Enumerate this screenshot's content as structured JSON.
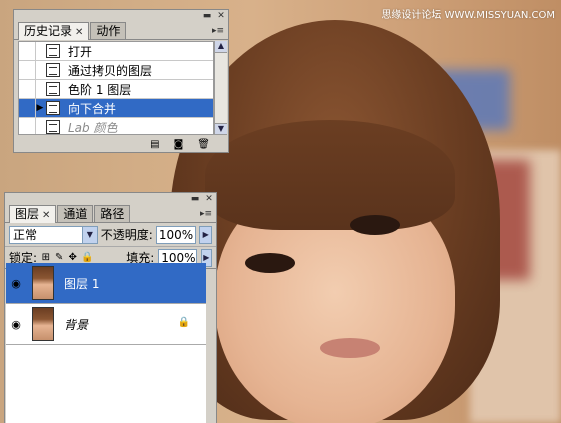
{
  "watermark": "思缘设计论坛 WWW.MISSYUAN.COM",
  "history_panel": {
    "tabs": [
      {
        "label": "历史记录",
        "active": true
      },
      {
        "label": "动作",
        "active": false
      }
    ],
    "items": [
      {
        "label": "打开",
        "state": "normal"
      },
      {
        "label": "通过拷贝的图层",
        "state": "normal"
      },
      {
        "label": "色阶 1 图层",
        "state": "normal"
      },
      {
        "label": "向下合并",
        "state": "selected"
      },
      {
        "label": "Lab 颜色",
        "state": "future"
      }
    ],
    "footer_icons": [
      "new-document-icon",
      "camera-icon",
      "trash-icon"
    ]
  },
  "layers_panel": {
    "tabs": [
      {
        "label": "图层",
        "active": true
      },
      {
        "label": "通道",
        "active": false
      },
      {
        "label": "路径",
        "active": false
      }
    ],
    "blend_mode": "正常",
    "opacity_label": "不透明度:",
    "opacity_value": "100%",
    "lock_label": "锁定:",
    "fill_label": "填充:",
    "fill_value": "100%",
    "layers": [
      {
        "name": "图层 1",
        "selected": true,
        "visible": true,
        "locked": false
      },
      {
        "name": "背景",
        "selected": false,
        "visible": true,
        "locked": true
      }
    ]
  },
  "colors": {
    "selection": "#316ac5",
    "panel_bg": "#d4d0c8"
  }
}
